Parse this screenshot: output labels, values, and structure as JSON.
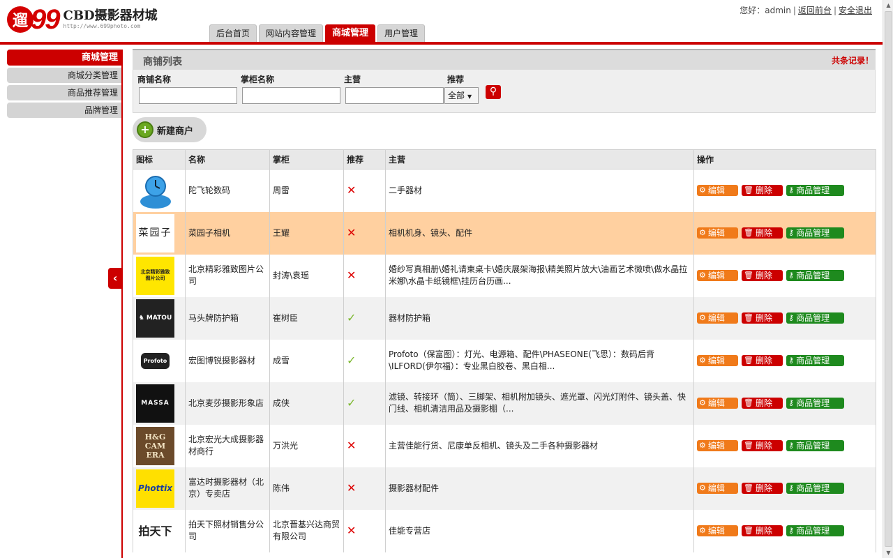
{
  "header": {
    "logo_badge": "遛",
    "logo_number": "99",
    "logo_name": "CBD摄影器材城",
    "logo_url": "http://www.699photo.com",
    "greeting": "您好：admin",
    "link_front": "返回前台",
    "link_logout": "安全退出"
  },
  "topnav": {
    "tabs": [
      {
        "label": "后台首页"
      },
      {
        "label": "网站内容管理"
      },
      {
        "label": "商城管理",
        "active": true
      },
      {
        "label": "用户管理"
      }
    ]
  },
  "sidebar": {
    "title": "商城管理",
    "items": [
      {
        "label": "商城分类管理"
      },
      {
        "label": "商品推荐管理"
      },
      {
        "label": "品牌管理"
      }
    ],
    "collapse": "‹"
  },
  "panel": {
    "title": "商铺列表",
    "count_text": "共条记录！"
  },
  "filters": {
    "shop_name_label": "商铺名称",
    "keeper_label": "掌柜名称",
    "main_label": "主营",
    "recommend_label": "推荐",
    "recommend_value": "全部",
    "shop_name_value": "",
    "keeper_value": "",
    "main_value": ""
  },
  "new_button": {
    "label": "新建商户"
  },
  "table": {
    "headers": [
      "图标",
      "名称",
      "掌柜",
      "推荐",
      "主营",
      "操作"
    ],
    "op_labels": {
      "edit": "编辑",
      "delete": "删除",
      "goods": "商品管理"
    },
    "rows": [
      {
        "logo": "avatar",
        "name": "陀飞轮数码",
        "keeper": "周雷",
        "recommend": false,
        "main": "二手器材"
      },
      {
        "logo": "菜园子",
        "name": "菜园子相机",
        "keeper": "王耀",
        "recommend": false,
        "main": "相机机身、镜头、配件",
        "highlight": true
      },
      {
        "logo": "北京精彩雅致图片公司",
        "name": "北京精彩雅致图片公司",
        "keeper": "封涛\\袁瑶",
        "recommend": false,
        "main": "婚纱写真相册\\婚礼请柬桌卡\\婚庆展架海报\\精美照片放大\\油画艺术微喷\\做水晶拉米娜\\水晶卡纸镜框\\挂历台历画..."
      },
      {
        "logo": "MATOU",
        "name": "马头牌防护箱",
        "keeper": "崔树臣",
        "recommend": true,
        "main": "器材防护箱"
      },
      {
        "logo": "Profoto",
        "name": "宏图博锐摄影器材",
        "keeper": "成雪",
        "recommend": true,
        "main": "Profoto（保富图）：灯光、电源箱、配件\\PHASEONE(飞思）：数码后背\\ILFORD(伊尔福）：专业黑白胶卷、黑白相..."
      },
      {
        "logo": "MASSA",
        "name": "北京麦莎摄影形象店",
        "keeper": "成侠",
        "recommend": true,
        "main": "滤镜、转接环（筒）、三脚架、相机附加镜头、遮光罩、闪光灯附件、镜头盖、快门线、相机清洁用品及摄影棚（..."
      },
      {
        "logo": "H&G CAMERA",
        "name": "北京宏光大成摄影器材商行",
        "keeper": "万洪光",
        "recommend": false,
        "main": "主营佳能行货、尼康单反相机、镜头及二手各种摄影器材"
      },
      {
        "logo": "Phottix",
        "name": "富达时摄影器材（北京）专卖店",
        "keeper": "陈伟",
        "recommend": false,
        "main": "摄影器材配件"
      },
      {
        "logo": "拍天下",
        "name": "拍天下照材销售分公司",
        "keeper": "北京晋基兴达商贸有限公司",
        "recommend": false,
        "main": "佳能专营店"
      }
    ]
  },
  "colors": {
    "brand_red": "#cc0000",
    "edit_orange": "#f07a1a",
    "goods_green": "#1e8a1e",
    "highlight_row": "#ffd0a0"
  }
}
